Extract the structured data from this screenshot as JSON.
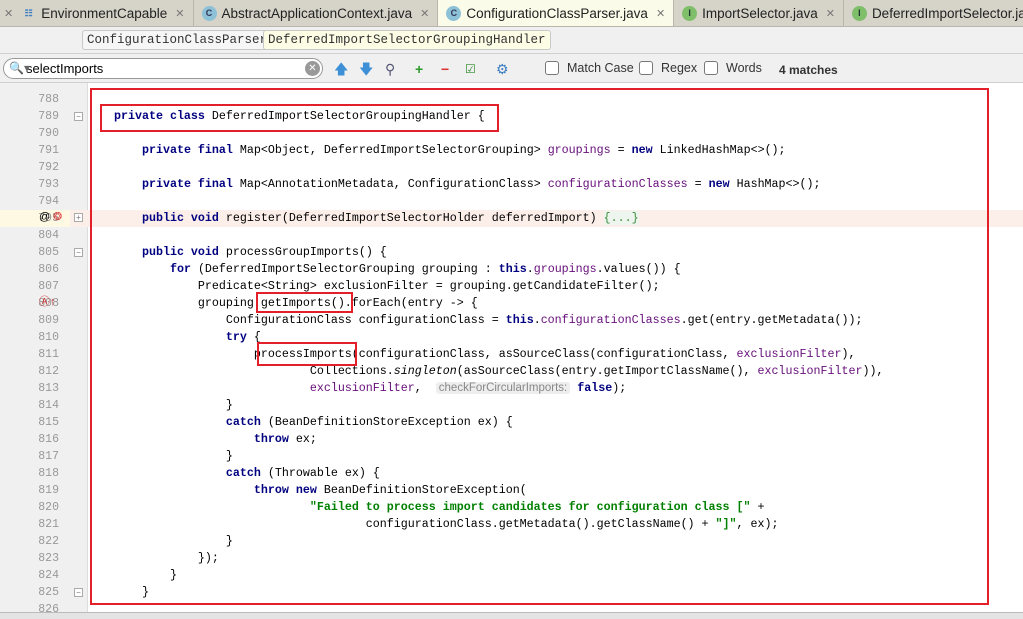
{
  "tabs": [
    {
      "label": "EnvironmentCapable",
      "icon": "e",
      "active": false
    },
    {
      "label": "AbstractApplicationContext.java",
      "icon": "c",
      "active": false
    },
    {
      "label": "ConfigurationClassParser.java",
      "icon": "c",
      "active": true
    },
    {
      "label": "ImportSelector.java",
      "icon": "i",
      "active": false
    },
    {
      "label": "DeferredImportSelector.java",
      "icon": "i",
      "active": false
    }
  ],
  "breadcrumb": [
    "ConfigurationClassParser",
    "DeferredImportSelectorGroupingHandler"
  ],
  "search": {
    "value": "selectImports",
    "match_case": "Match Case",
    "regex": "Regex",
    "words": "Words",
    "matches": "4 matches"
  },
  "colors": {
    "keyword": "#000080",
    "field": "#660e7a",
    "string": "#008000",
    "highlight_box": "#e3202a"
  },
  "code": {
    "lines": [
      {
        "n": "788",
        "t": []
      },
      {
        "n": "789",
        "t": [
          [
            "p",
            "    "
          ],
          [
            "kw",
            "private class "
          ],
          [
            "p",
            "DeferredImportSelectorGroupingHandler {"
          ]
        ]
      },
      {
        "n": "790",
        "t": []
      },
      {
        "n": "791",
        "t": [
          [
            "p",
            "        "
          ],
          [
            "kw",
            "private final "
          ],
          [
            "p",
            "Map<Object, DeferredImportSelectorGrouping> "
          ],
          [
            "fld",
            "groupings"
          ],
          [
            "p",
            " = "
          ],
          [
            "kw",
            "new "
          ],
          [
            "p",
            "LinkedHashMap<>();"
          ]
        ]
      },
      {
        "n": "792",
        "t": []
      },
      {
        "n": "793",
        "t": [
          [
            "p",
            "        "
          ],
          [
            "kw",
            "private final "
          ],
          [
            "p",
            "Map<AnnotationMetadata, ConfigurationClass> "
          ],
          [
            "fld",
            "configurationClasses"
          ],
          [
            "p",
            " = "
          ],
          [
            "kw",
            "new "
          ],
          [
            "p",
            "HashMap<>();"
          ]
        ]
      },
      {
        "n": "794",
        "t": []
      },
      {
        "n": "795",
        "t": [
          [
            "p",
            "        "
          ],
          [
            "kw",
            "public void "
          ],
          [
            "p",
            "register(DeferredImportSelectorHolder deferredImport) "
          ],
          [
            "fold",
            "{...}"
          ]
        ]
      },
      {
        "n": "804",
        "t": []
      },
      {
        "n": "805",
        "t": [
          [
            "p",
            "        "
          ],
          [
            "kw",
            "public void "
          ],
          [
            "p",
            "processGroupImports() {"
          ]
        ]
      },
      {
        "n": "806",
        "t": [
          [
            "p",
            "            "
          ],
          [
            "kw",
            "for "
          ],
          [
            "p",
            "(DeferredImportSelectorGrouping grouping : "
          ],
          [
            "kw",
            "this"
          ],
          [
            "p",
            "."
          ],
          [
            "fld",
            "groupings"
          ],
          [
            "p",
            ".values()) {"
          ]
        ]
      },
      {
        "n": "807",
        "t": [
          [
            "p",
            "                Predicate<String> exclusionFilter = grouping.getCandidateFilter();"
          ]
        ]
      },
      {
        "n": "808",
        "t": [
          [
            "p",
            "                grouping.getImports().forEach(entry -> {"
          ]
        ]
      },
      {
        "n": "809",
        "t": [
          [
            "p",
            "                    ConfigurationClass configurationClass = "
          ],
          [
            "kw",
            "this"
          ],
          [
            "p",
            "."
          ],
          [
            "fld",
            "configurationClasses"
          ],
          [
            "p",
            ".get(entry.getMetadata());"
          ]
        ]
      },
      {
        "n": "810",
        "t": [
          [
            "p",
            "                    "
          ],
          [
            "kw",
            "try "
          ],
          [
            "p",
            "{"
          ]
        ]
      },
      {
        "n": "811",
        "t": [
          [
            "p",
            "                        processImports(configurationClass, asSourceClass(configurationClass, "
          ],
          [
            "fld",
            "exclusionFilter"
          ],
          [
            "p",
            "),"
          ]
        ]
      },
      {
        "n": "812",
        "t": [
          [
            "p",
            "                                Collections."
          ],
          [
            "it",
            "singleton"
          ],
          [
            "p",
            "(asSourceClass(entry.getImportClassName(), "
          ],
          [
            "fld",
            "exclusionFilter"
          ],
          [
            "p",
            ")),"
          ]
        ]
      },
      {
        "n": "813",
        "t": [
          [
            "p",
            "                                "
          ],
          [
            "fld",
            "exclusionFilter"
          ],
          [
            "p",
            ",  "
          ],
          [
            "hint",
            "checkForCircularImports:"
          ],
          [
            "p",
            " "
          ],
          [
            "kw",
            "false"
          ],
          [
            "p",
            ");"
          ]
        ]
      },
      {
        "n": "814",
        "t": [
          [
            "p",
            "                    }"
          ]
        ]
      },
      {
        "n": "815",
        "t": [
          [
            "p",
            "                    "
          ],
          [
            "kw",
            "catch "
          ],
          [
            "p",
            "(BeanDefinitionStoreException ex) {"
          ]
        ]
      },
      {
        "n": "816",
        "t": [
          [
            "p",
            "                        "
          ],
          [
            "kw",
            "throw "
          ],
          [
            "p",
            "ex;"
          ]
        ]
      },
      {
        "n": "817",
        "t": [
          [
            "p",
            "                    }"
          ]
        ]
      },
      {
        "n": "818",
        "t": [
          [
            "p",
            "                    "
          ],
          [
            "kw",
            "catch "
          ],
          [
            "p",
            "(Throwable ex) {"
          ]
        ]
      },
      {
        "n": "819",
        "t": [
          [
            "p",
            "                        "
          ],
          [
            "kw",
            "throw new "
          ],
          [
            "p",
            "BeanDefinitionStoreException("
          ]
        ]
      },
      {
        "n": "820",
        "t": [
          [
            "p",
            "                                "
          ],
          [
            "str",
            "\"Failed to process import candidates for configuration class [\""
          ],
          [
            "p",
            " +"
          ]
        ]
      },
      {
        "n": "821",
        "t": [
          [
            "p",
            "                                        configurationClass.getMetadata().getClassName() + "
          ],
          [
            "str",
            "\"]\""
          ],
          [
            "p",
            ", ex);"
          ]
        ]
      },
      {
        "n": "822",
        "t": [
          [
            "p",
            "                    }"
          ]
        ]
      },
      {
        "n": "823",
        "t": [
          [
            "p",
            "                });"
          ]
        ]
      },
      {
        "n": "824",
        "t": [
          [
            "p",
            "            }"
          ]
        ]
      },
      {
        "n": "825",
        "t": [
          [
            "p",
            "        }"
          ]
        ]
      },
      {
        "n": "826",
        "t": []
      }
    ]
  }
}
